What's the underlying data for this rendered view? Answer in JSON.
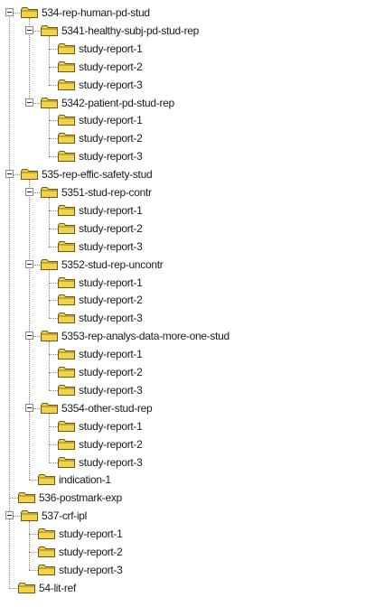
{
  "tree": [
    {
      "label": "534-rep-human-pd-stud",
      "expanded": true,
      "icon": "folder-icon",
      "children": [
        {
          "label": "5341-healthy-subj-pd-stud-rep",
          "expanded": true,
          "icon": "folder-icon",
          "children": [
            {
              "label": "study-report-1",
              "icon": "folder-icon"
            },
            {
              "label": "study-report-2",
              "icon": "folder-icon"
            },
            {
              "label": "study-report-3",
              "icon": "folder-icon"
            }
          ]
        },
        {
          "label": "5342-patient-pd-stud-rep",
          "expanded": true,
          "icon": "folder-icon",
          "children": [
            {
              "label": "study-report-1",
              "icon": "folder-icon"
            },
            {
              "label": "study-report-2",
              "icon": "folder-icon"
            },
            {
              "label": "study-report-3",
              "icon": "folder-icon"
            }
          ]
        }
      ]
    },
    {
      "label": "535-rep-effic-safety-stud",
      "expanded": true,
      "icon": "folder-icon",
      "children": [
        {
          "label": "5351-stud-rep-contr",
          "expanded": true,
          "icon": "folder-icon",
          "children": [
            {
              "label": "study-report-1",
              "icon": "folder-icon"
            },
            {
              "label": "study-report-2",
              "icon": "folder-icon"
            },
            {
              "label": "study-report-3",
              "icon": "folder-icon"
            }
          ]
        },
        {
          "label": "5352-stud-rep-uncontr",
          "expanded": true,
          "icon": "folder-icon",
          "children": [
            {
              "label": "study-report-1",
              "icon": "folder-icon"
            },
            {
              "label": "study-report-2",
              "icon": "folder-icon"
            },
            {
              "label": "study-report-3",
              "icon": "folder-icon"
            }
          ]
        },
        {
          "label": "5353-rep-analys-data-more-one-stud",
          "expanded": true,
          "icon": "folder-icon",
          "children": [
            {
              "label": "study-report-1",
              "icon": "folder-icon"
            },
            {
              "label": "study-report-2",
              "icon": "folder-icon"
            },
            {
              "label": "study-report-3",
              "icon": "folder-icon"
            }
          ]
        },
        {
          "label": "5354-other-stud-rep",
          "expanded": true,
          "icon": "folder-icon",
          "children": [
            {
              "label": "study-report-1",
              "icon": "folder-icon"
            },
            {
              "label": "study-report-2",
              "icon": "folder-icon"
            },
            {
              "label": "study-report-3",
              "icon": "folder-icon"
            }
          ]
        },
        {
          "label": "indication-1",
          "icon": "folder-icon"
        }
      ]
    },
    {
      "label": "536-postmark-exp",
      "icon": "folder-icon"
    },
    {
      "label": "537-crf-ipl",
      "expanded": true,
      "icon": "folder-icon",
      "children": [
        {
          "label": "study-report-1",
          "icon": "folder-icon"
        },
        {
          "label": "study-report-2",
          "icon": "folder-icon"
        },
        {
          "label": "study-report-3",
          "icon": "folder-icon"
        }
      ]
    },
    {
      "label": "54-lit-ref",
      "icon": "folder-icon"
    }
  ],
  "colors": {
    "folder_fill": "#f2d24a",
    "folder_stroke": "#6b5a10",
    "connector": "#8a8a8a",
    "text": "#1a1a1a"
  }
}
